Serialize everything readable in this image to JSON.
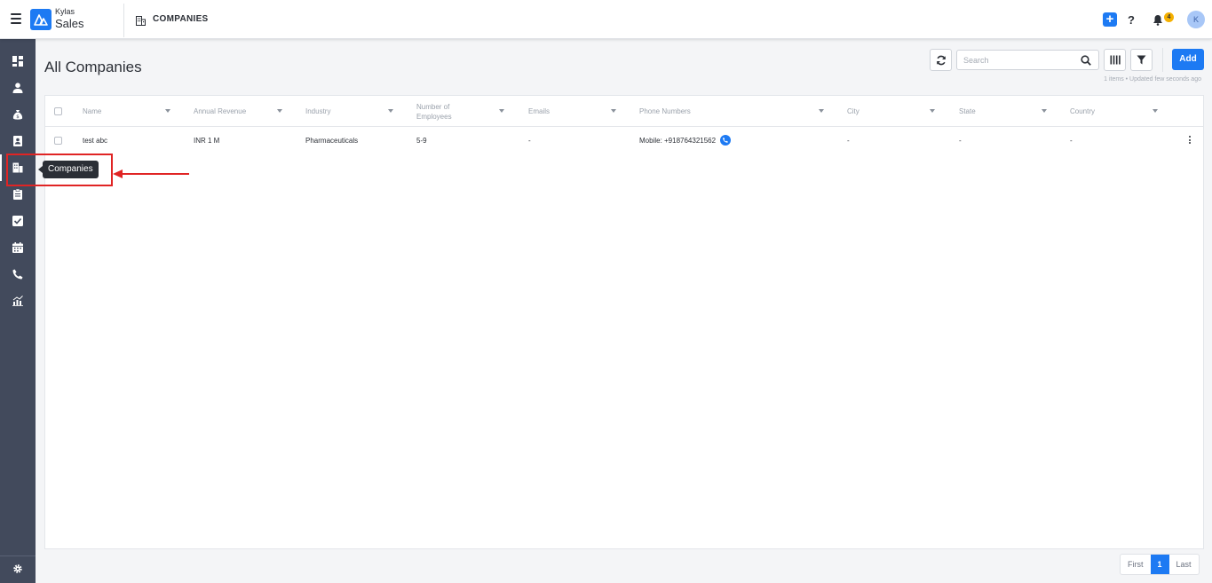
{
  "header": {
    "brand_name": "Kylas",
    "brand_product": "Sales",
    "breadcrumb_title": "COMPANIES",
    "notification_count": "4",
    "avatar_initial": "K",
    "help_label": "?"
  },
  "sidebar": {
    "items": [
      {
        "name": "dashboard-icon"
      },
      {
        "name": "user-icon"
      },
      {
        "name": "deals-icon"
      },
      {
        "name": "contacts-icon"
      },
      {
        "name": "companies-icon"
      },
      {
        "name": "report-icon"
      },
      {
        "name": "tasks-icon"
      },
      {
        "name": "calendar-icon"
      },
      {
        "name": "phone-icon"
      },
      {
        "name": "analytics-icon"
      }
    ],
    "settings_icon": "gear-icon",
    "tooltip": "Companies"
  },
  "main": {
    "title": "All Companies",
    "search_placeholder": "Search",
    "add_label": "Add",
    "meta": "1 items • Updated few seconds ago"
  },
  "table": {
    "columns": [
      "Name",
      "Annual Revenue",
      "Industry",
      "Number of Employees",
      "Emails",
      "Phone Numbers",
      "City",
      "State",
      "Country"
    ],
    "rows": [
      {
        "name": "test abc",
        "annual_revenue": "INR 1 M",
        "industry": "Pharmaceuticals",
        "employees": "5-9",
        "emails": "-",
        "phone": "Mobile: +918764321562",
        "city": "-",
        "state": "-",
        "country": "-"
      }
    ]
  },
  "pagination": {
    "first": "First",
    "current": "1",
    "last": "Last"
  },
  "colors": {
    "accent": "#1d7af3",
    "sidebar": "#424a5c",
    "annotation": "#e02424",
    "badge": "#f5b000"
  }
}
